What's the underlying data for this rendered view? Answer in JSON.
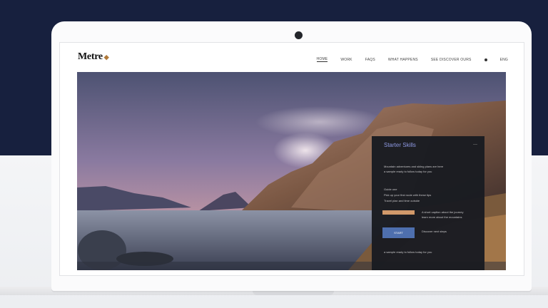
{
  "site": {
    "logo_text": "Metre",
    "logo_icon": "brand-mark-icon"
  },
  "nav": {
    "items": [
      "HOME",
      "WORK",
      "FAQS",
      "WHAT HAPPENS",
      "SEE DISCOVER OURS"
    ],
    "active_index": 0,
    "extra_icon": "dot-icon",
    "extra_label": "ENG"
  },
  "panel": {
    "title": "Starter Skills",
    "close_label": "—",
    "lines": [
      "Mountain adventures and skiing plans are here",
      "a sample ready to follow today for you",
      "Guide one",
      "Pick up your first route with these tips",
      "Travel plan and time outside"
    ],
    "side_lines": [
      "A short caption about the journey",
      "learn more about the mountains",
      "Discover next steps"
    ],
    "primary_button": "",
    "secondary_button": "START"
  },
  "colors": {
    "page_background": "#17203e",
    "panel_background": "#1a1c22",
    "panel_title": "#8e9be8",
    "primary_button": "#d49a6a",
    "secondary_button": "#4d70b2"
  }
}
